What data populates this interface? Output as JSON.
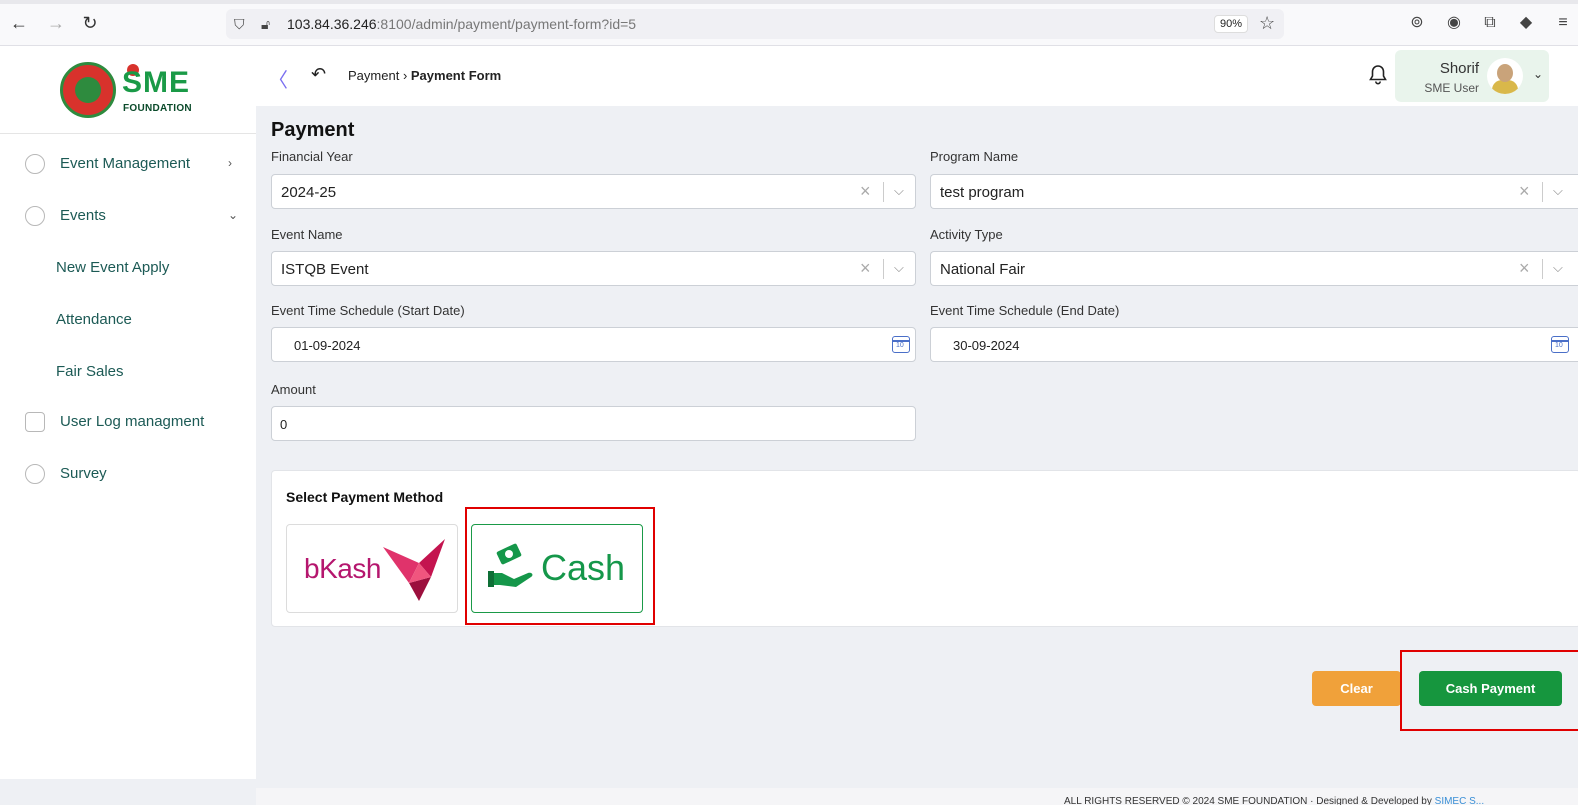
{
  "browser": {
    "url_host": "103.84.36.246",
    "url_rest": ":8100/admin/payment/payment-form?id=5",
    "zoom": "90%"
  },
  "logo": {
    "brand": "SME",
    "subtitle": "FOUNDATION"
  },
  "sidebar": {
    "items": [
      {
        "label": "Event Management"
      },
      {
        "label": "Events"
      },
      {
        "label": "User Log managment"
      },
      {
        "label": "Survey"
      }
    ],
    "sub_items": [
      {
        "label": "New Event Apply"
      },
      {
        "label": "Attendance"
      },
      {
        "label": "Fair Sales"
      }
    ]
  },
  "header": {
    "breadcrumb_parent": "Payment",
    "breadcrumb_current": "Payment Form",
    "user_name": "Shorif",
    "user_role": "SME User"
  },
  "form": {
    "title": "Payment",
    "financial_year": {
      "label": "Financial Year",
      "value": "2024-25"
    },
    "program_name": {
      "label": "Program Name",
      "value": "test program"
    },
    "event_name": {
      "label": "Event Name",
      "value": "ISTQB Event"
    },
    "activity_type": {
      "label": "Activity Type",
      "value": "National Fair"
    },
    "start_date": {
      "label": "Event Time Schedule (Start Date)",
      "value": "01-09-2024"
    },
    "end_date": {
      "label": "Event Time Schedule (End Date)",
      "value": "30-09-2024"
    },
    "amount": {
      "label": "Amount",
      "value": "0"
    }
  },
  "payment_method": {
    "title": "Select Payment Method",
    "bkash_label": "bKash",
    "cash_label": "Cash",
    "selected": "Cash"
  },
  "actions": {
    "clear_label": "Clear",
    "cash_payment_label": "Cash Payment"
  },
  "footer": {
    "text": "ALL RIGHTS RESERVED © 2024 SME FOUNDATION · Designed & Developed by ",
    "link": "SIMEC S..."
  },
  "colors": {
    "brand_green": "#16963e",
    "clear_orange": "#f0a13a",
    "highlight_red": "#e00000",
    "bkash_pink": "#b5166e"
  }
}
